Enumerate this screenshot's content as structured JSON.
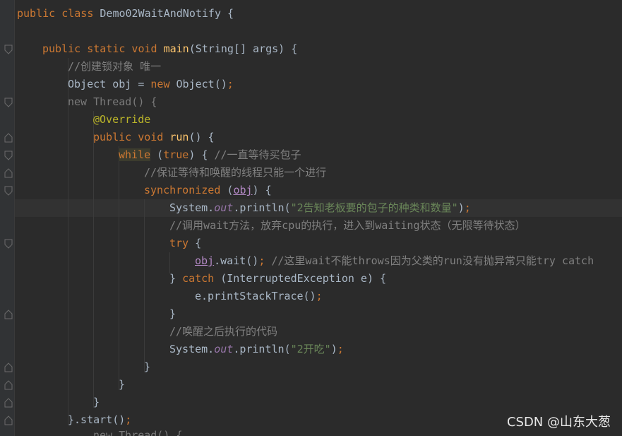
{
  "code": {
    "l1_kw": "public class",
    "l1_name": " Demo02WaitAndNotify {",
    "l2_kw": "public static void",
    "l2_fn": "main",
    "l2_rest": "(String[] args) {",
    "l3": "//创建锁对象 唯一",
    "l4_a": "Object obj = ",
    "l4_kw": "new",
    "l4_b": " Object()",
    "l4_semi": ";",
    "l5_kw": "new",
    "l5_rest": " Thread() {",
    "l6": "@Override",
    "l7_kw": "public void",
    "l7_fn": "run",
    "l7_rest": "() {",
    "l8_kw": "while",
    "l8_a": " (",
    "l8_true": "true",
    "l8_b": ") { ",
    "l8_cm": "//一直等待买包子",
    "l9": "//保证等待和唤醒的线程只能一个进行",
    "l10_kw": "synchronized",
    "l10_a": " (",
    "l10_obj": "obj",
    "l10_b": ") {",
    "l11_a": "System.",
    "l11_out": "out",
    "l11_b": ".println(",
    "l11_str": "\"2告知老板要的包子的种类和数量\"",
    "l11_c": ")",
    "l11_semi": ";",
    "l12": "//调用wait方法，放弃cpu的执行，进入到waiting状态（无限等待状态）",
    "l13_kw": "try",
    "l13_rest": " {",
    "l14_obj": "obj",
    "l14_a": ".wait()",
    "l14_semi": ";",
    "l14_cm": " //这里wait不能throws因为父类的run没有抛异常只能try catch",
    "l15_a": "} ",
    "l15_kw": "catch",
    "l15_rest": " (InterruptedException e) {",
    "l16_a": "e.printStackTrace()",
    "l16_semi": ";",
    "l17": "}",
    "l18": "//唤醒之后执行的代码",
    "l19_a": "System.",
    "l19_out": "out",
    "l19_b": ".println(",
    "l19_str": "\"2开吃\"",
    "l19_c": ")",
    "l19_semi": ";",
    "l20": "}",
    "l21": "}",
    "l22": "}",
    "l23_a": "}.start()",
    "l23_semi": ";",
    "l24": "new Thread() {"
  },
  "watermark": "CSDN @山东大葱",
  "colors": {
    "background": "#2b2b2b",
    "keyword": "#cc7832",
    "function": "#ffc66d",
    "comment": "#808080",
    "string": "#6a8759",
    "annotation": "#bbb529",
    "field": "#9876aa"
  }
}
